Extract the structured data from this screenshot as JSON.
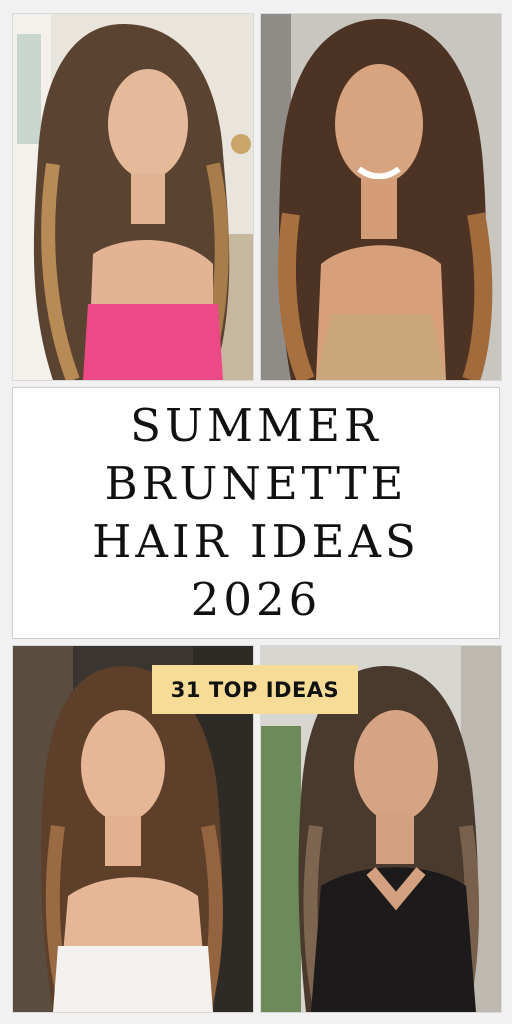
{
  "title": {
    "lines": [
      "SUMMER",
      "BRUNETTE",
      "HAIR IDEAS",
      "2026"
    ]
  },
  "badge": {
    "label": "31 TOP IDEAS"
  },
  "colors": {
    "background": "#f1f1f1",
    "badge": "#f7dc97",
    "title_text": "#111111"
  },
  "photos": [
    {
      "subject": "woman with long wavy brunette hair with caramel highlights, pink top",
      "image_icon": "photo-icon"
    },
    {
      "subject": "smiling woman with long brunette balayage waves, beige knit top",
      "image_icon": "photo-icon"
    },
    {
      "subject": "young woman with brunette layered hair and curtain bangs, white top",
      "image_icon": "photo-icon"
    },
    {
      "subject": "woman with straight dark brunette hair with bangs, black top",
      "image_icon": "photo-icon"
    }
  ]
}
